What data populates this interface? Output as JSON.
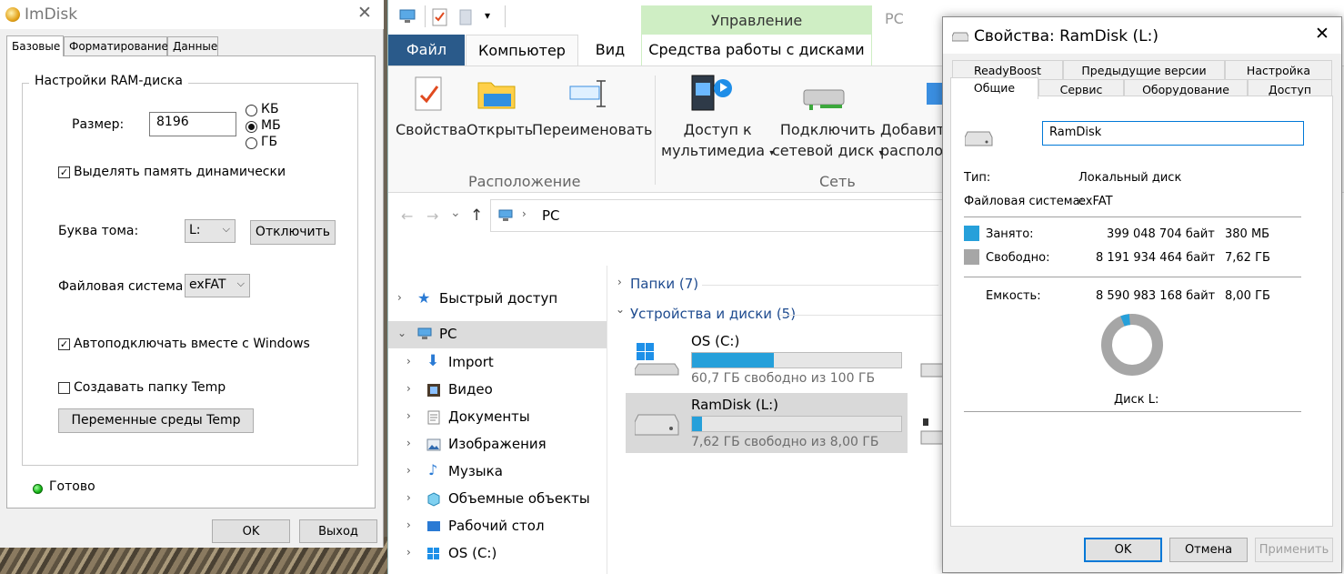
{
  "imdisk": {
    "title": "ImDisk",
    "tabs": [
      "Базовые",
      "Форматирование",
      "Данные"
    ],
    "group_title": "Настройки RAM-диска",
    "size_label": "Размер:",
    "size_value": "8196",
    "units": [
      "КБ",
      "МБ",
      "ГБ"
    ],
    "selected_unit": "МБ",
    "dynamic_memory": "Выделять память динамически",
    "drive_letter_label": "Буква тома:",
    "drive_letter_value": "L:",
    "unmount_button": "Отключить",
    "filesystem_label": "Файловая система:",
    "filesystem_value": "exFAT",
    "autostart": "Автоподключать вместе с Windows",
    "create_temp": "Создавать папку Temp",
    "temp_env_button": "Переменные среды Temp",
    "status": "Готово",
    "ok_button": "OK",
    "exit_button": "Выход"
  },
  "explorer": {
    "ribbon_tabs": {
      "file": "Файл",
      "computer": "Компьютер",
      "view": "Вид",
      "manage_header": "Управление",
      "disk_tools": "Средства работы с дисками"
    },
    "window_title": "PC",
    "ribbon": {
      "properties": "Свойства",
      "open": "Открыть",
      "rename": "Переименовать",
      "group_location": "Расположение",
      "media_access_1": "Доступ к",
      "media_access_2": "мультимедиа",
      "map_drive_1": "Подключить",
      "map_drive_2": "сетевой диск",
      "add_location_1": "Добавит",
      "add_location_2": "располо",
      "group_network": "Сеть"
    },
    "address": "PC",
    "nav": [
      {
        "label": "Быстрый доступ",
        "icon": "star-icon"
      },
      {
        "label": "PC",
        "icon": "computer-icon"
      },
      {
        "label": "Import",
        "icon": "download-arrow-icon"
      },
      {
        "label": "Видео",
        "icon": "film-icon"
      },
      {
        "label": "Документы",
        "icon": "document-icon"
      },
      {
        "label": "Изображения",
        "icon": "picture-icon"
      },
      {
        "label": "Музыка",
        "icon": "music-note-icon"
      },
      {
        "label": "Объемные объекты",
        "icon": "cube-icon"
      },
      {
        "label": "Рабочий стол",
        "icon": "desktop-icon"
      },
      {
        "label": "OS (C:)",
        "icon": "windows-drive-icon"
      }
    ],
    "sections": {
      "folders": "Папки (7)",
      "devices": "Устройства и диски (5)"
    },
    "drives": [
      {
        "name": "OS (C:)",
        "free": "60,7 ГБ свободно из 100 ГБ",
        "used_fraction": 0.393
      },
      {
        "name": "RamDisk (L:)",
        "free": "7,62 ГБ свободно из 8,00 ГБ",
        "used_fraction": 0.047
      }
    ]
  },
  "props": {
    "title": "Свойства: RamDisk (L:)",
    "tabs_top": [
      "ReadyBoost",
      "Предыдущие версии",
      "Настройка"
    ],
    "tabs_bottom": [
      "Общие",
      "Сервис",
      "Оборудование",
      "Доступ"
    ],
    "name_value": "RamDisk",
    "type_label": "Тип:",
    "type_value": "Локальный диск",
    "fs_label": "Файловая система:",
    "fs_value": "exFAT",
    "used_label": "Занято:",
    "used_bytes": "399 048 704 байт",
    "used_short": "380 МБ",
    "free_label": "Свободно:",
    "free_bytes": "8 191 934 464 байт",
    "free_short": "7,62 ГБ",
    "capacity_label": "Емкость:",
    "capacity_bytes": "8 590 983 168 байт",
    "capacity_short": "8,00 ГБ",
    "disk_label": "Диск L:",
    "used_fraction": 0.046,
    "colors": {
      "used": "#26a0da",
      "free": "#a6a6a6"
    },
    "ok_button": "OK",
    "cancel_button": "Отмена",
    "apply_button": "Применить"
  }
}
